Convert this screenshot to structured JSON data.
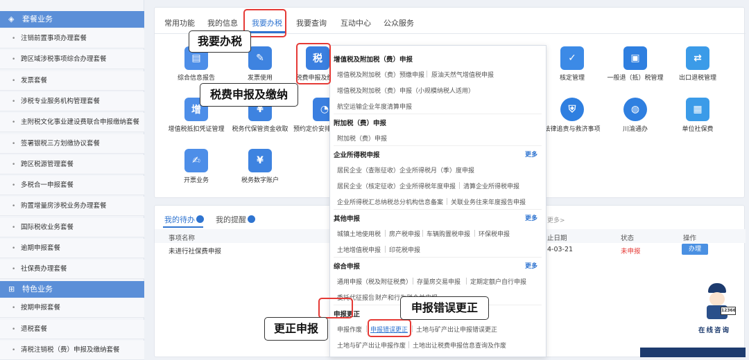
{
  "sidebar": {
    "section1_title": "套餐业务",
    "section1_items": [
      "注销前置事项办理套餐",
      "跨区域涉税事项综合办理套餐",
      "发票套餐",
      "涉税专业服务机构管理套餐",
      "主附税文化事业建设费联合申报缴纳套餐",
      "签署银税三方划缴协议套餐",
      "跨区税源管理套餐",
      "多税合一申报套餐",
      "购置增量房涉税业务办理套餐",
      "国际税收业务套餐",
      "逾期申报套餐",
      "社保费办理套餐"
    ],
    "section2_title": "特色业务",
    "section2_items": [
      "按期申报套餐",
      "退税套餐",
      "清税注销税（费）申报及缴纳套餐"
    ]
  },
  "tabs": [
    "常用功能",
    "我的信息",
    "我要办税",
    "我要查询",
    "互动中心",
    "公众服务"
  ],
  "active_tab": "我要办税",
  "services_row1": [
    {
      "label": "综合信息报告",
      "color": "#4d8ee8",
      "icon": "report-icon"
    },
    {
      "label": "发票使用",
      "color": "#3e83e0",
      "icon": "invoice-icon"
    },
    {
      "label": "税费申报及缴纳",
      "color": "#3a7fe0",
      "icon": "tax-declare-icon"
    },
    {
      "label": "核定管理",
      "color": "#3c8ae6",
      "icon": "verify-icon"
    },
    {
      "label": "一般退（抵）税管理",
      "color": "#e05a3a",
      "icon": "refund-icon"
    },
    {
      "label": "出口退税管理",
      "color": "#3b9be8",
      "icon": "export-icon"
    }
  ],
  "services_row2": [
    {
      "label": "增值税抵扣凭证管理",
      "color": "#4d8ee8",
      "icon": "vat-deduct-icon",
      "glyph": "增"
    },
    {
      "label": "税务代保管资金收取",
      "color": "#3e83e0",
      "icon": "custody-icon"
    },
    {
      "label": "预约定价安排谈签申请",
      "color": "#3a7fe0",
      "icon": "pricing-icon"
    },
    {
      "label": "法律追责与救济事项",
      "color": "#2f7fe0",
      "icon": "legal-icon"
    },
    {
      "label": "川渝通办",
      "color": "#2f7fe0",
      "icon": "globe-icon"
    },
    {
      "label": "单位社保费",
      "color": "#3b9be8",
      "icon": "social-security-icon"
    }
  ],
  "services_row3": [
    {
      "label": "开票业务",
      "color": "#4d8ee8",
      "icon": "invoicing-icon"
    },
    {
      "label": "税务数字账户",
      "color": "#3e83e0",
      "icon": "digital-account-icon"
    }
  ],
  "dropdown": {
    "group1_title": "增值税及附加税（费）申报",
    "group1_items": [
      "增值税及附加税（费）预缴申报",
      "原油天然气增值税申报",
      "增值税及附加税（费）申报（小规模纳税人适用）",
      "航空运输企业年度清算申报"
    ],
    "group2_title": "附加税（费）申报",
    "group2_items": [
      "附加税（费）申报"
    ],
    "group3_title": "企业所得税申报",
    "group3_items": [
      "居民企业（查账征收）企业所得税月（季）度申报",
      "居民企业（核定征收）企业所得税年度申报",
      "清算企业所得税申报",
      "企业所得税汇总纳税总分机构信息备案",
      "关联业务往来年度报告申报"
    ],
    "group4_title": "其他申报",
    "group4_items": [
      "城镇土地使用税",
      "房产税申报",
      "车辆购置税申报",
      "环保税申报",
      "土地增值税申报",
      "印花税申报"
    ],
    "group5_title": "综合申报",
    "group5_items": [
      "通用申报（税及附征税费）",
      "存量房交易申报",
      "定期定额户自行申报",
      "委托代征报告",
      "财产和行为税合并申报"
    ],
    "group6_title": "申报更正",
    "group6_items": [
      "申报作废",
      "申报错误更正",
      "土地与矿产出让申报错误更正",
      "土地与矿产出让申报作废",
      "土地出让税费申报信息查询及作废"
    ],
    "more": "更多"
  },
  "lower": {
    "tab_todo": "我的待办",
    "tab_reminder": "我的提醒",
    "more_link": "更多>",
    "col_item": "事项名称",
    "col_date": "止日期",
    "col_status": "状态",
    "col_action": "操作",
    "row_item": "未进行社保费申报",
    "row_date": "4-03-21",
    "row_status": "未申报",
    "row_action": "办理"
  },
  "callouts": {
    "c1": "我要办税",
    "c2": "税费申报及缴纳",
    "c3": "申报错误更正",
    "c4": "更正申报"
  },
  "assistant_label": "在线咨询",
  "assistant_badge": "12366",
  "colors": {
    "accent": "#2f74d0",
    "sidebar_head": "#5b8fd8",
    "highlight": "#e53935",
    "status_red": "#e53935"
  }
}
